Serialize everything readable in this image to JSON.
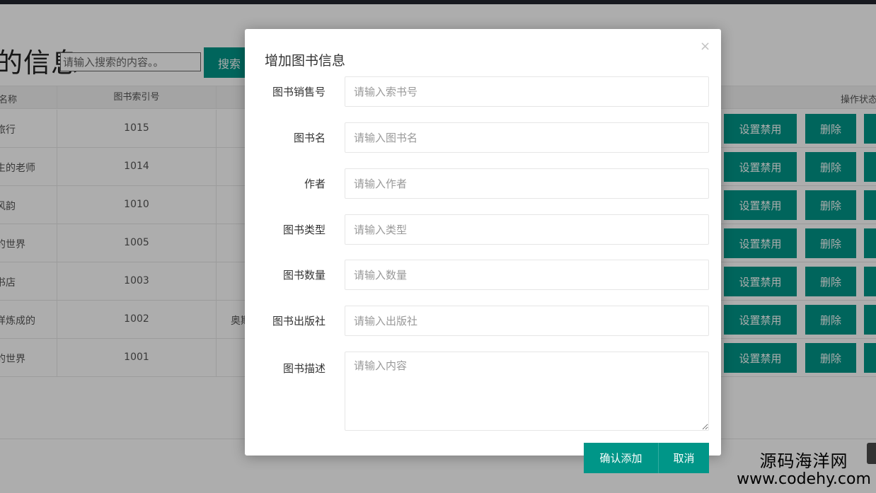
{
  "page": {
    "title": "的信息",
    "search_placeholder": "请输入搜索的内容。。",
    "search_button": "搜索"
  },
  "table": {
    "headers": {
      "name": "名称",
      "index": "图书索引号",
      "ops": "操作状态"
    },
    "rows": [
      {
        "name": "旅行",
        "index": "1015",
        "extra": ""
      },
      {
        "name": "生的老师",
        "index": "1014",
        "extra": ""
      },
      {
        "name": "风韵",
        "index": "1010",
        "extra": ""
      },
      {
        "name": "的世界",
        "index": "1005",
        "extra": ""
      },
      {
        "name": "书店",
        "index": "1003",
        "extra": ""
      },
      {
        "name": "样炼成的",
        "index": "1002",
        "extra": "奥斯"
      },
      {
        "name": "的世界",
        "index": "1001",
        "extra": ""
      }
    ],
    "row_buttons": {
      "ban": "设置禁用",
      "delete": "删除"
    }
  },
  "modal": {
    "title": "增加图书信息",
    "close": "×",
    "fields": [
      {
        "label": "图书销售号",
        "placeholder": "请输入索书号"
      },
      {
        "label": "图书名",
        "placeholder": "请输入图书名"
      },
      {
        "label": "作者",
        "placeholder": "请输入作者"
      },
      {
        "label": "图书类型",
        "placeholder": "请输入类型"
      },
      {
        "label": "图书数量",
        "placeholder": "请输入数量"
      },
      {
        "label": "图书出版社",
        "placeholder": "请输入出版社"
      }
    ],
    "description": {
      "label": "图书描述",
      "placeholder": "请输入内容"
    },
    "confirm": "确认添加",
    "cancel": "取消"
  },
  "watermark": {
    "cn": "源码海洋网",
    "en": "www.codehy.com"
  },
  "colors": {
    "primary": "#009688",
    "topbar": "#23262e"
  }
}
